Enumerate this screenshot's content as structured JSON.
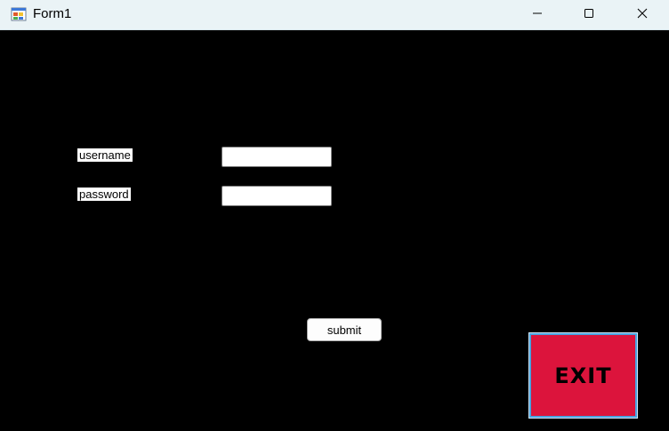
{
  "window": {
    "title": "Form1",
    "icon": "winforms-app-icon"
  },
  "controls": {
    "minimize_icon": "minimize-icon",
    "maximize_icon": "maximize-icon",
    "close_icon": "close-icon"
  },
  "form": {
    "username_label": "username",
    "password_label": "password",
    "username_value": "",
    "password_value": "",
    "submit_label": "submit",
    "exit_label": "EXIT"
  },
  "colors": {
    "background": "#000000",
    "exit_button": "#dc143c",
    "titlebar": "#eaf3f6"
  }
}
